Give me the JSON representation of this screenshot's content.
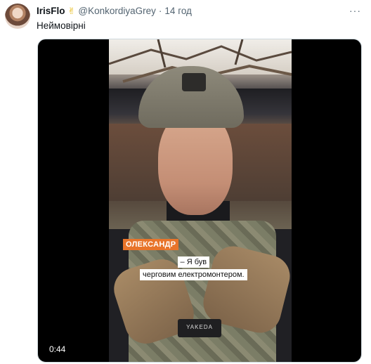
{
  "tweet": {
    "display_name": "IrisFlo",
    "badge_emoji": "✌",
    "handle": "@KonkordiyaGrey",
    "separator": "·",
    "time": "14 год",
    "more": "···",
    "text": "Неймовірні"
  },
  "video": {
    "name_tag": "ОЛЕКСАНДР",
    "subtitle_line1": "– Я був",
    "subtitle_line2": "черговим електромонтером.",
    "patch_text": "YAKEDA",
    "duration": "0:44"
  },
  "colors": {
    "name_tag_bg": "#e8742a",
    "secondary_text": "#536471"
  }
}
